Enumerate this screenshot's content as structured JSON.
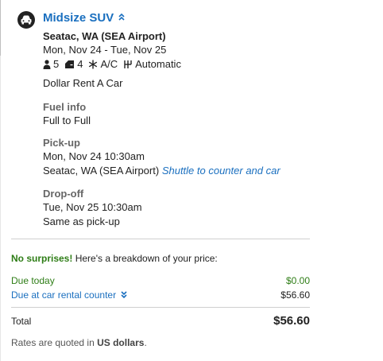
{
  "car": {
    "title": "Midsize SUV",
    "toggle_glyph": "⌃",
    "location": "Seatac, WA (SEA Airport)",
    "dates": "Mon, Nov 24 - Tue, Nov 25",
    "features": {
      "passengers": "5",
      "bags": "4",
      "ac": "A/C",
      "transmission": "Automatic"
    },
    "vendor": "Dollar Rent A Car"
  },
  "fuel": {
    "label": "Fuel info",
    "value": "Full to Full"
  },
  "pickup": {
    "label": "Pick-up",
    "datetime": "Mon, Nov 24 10:30am",
    "place": "Seatac, WA (SEA Airport)",
    "shuttle": "Shuttle to counter and car"
  },
  "dropoff": {
    "label": "Drop-off",
    "datetime": "Tue, Nov 25 10:30am",
    "place": "Same as pick-up"
  },
  "price": {
    "headline_bold": "No surprises!",
    "headline_rest": " Here's a breakdown of your price:",
    "due_today_label": "Due today",
    "due_today_value": "$0.00",
    "due_counter_label": "Due at car rental counter",
    "due_counter_value": "$56.60",
    "total_label": "Total",
    "total_value": "$56.60",
    "note_prefix": "Rates are quoted in ",
    "note_bold": "US dollars",
    "note_suffix": "."
  },
  "colors": {
    "link": "#1a6fbf",
    "green": "#2e7d16"
  }
}
